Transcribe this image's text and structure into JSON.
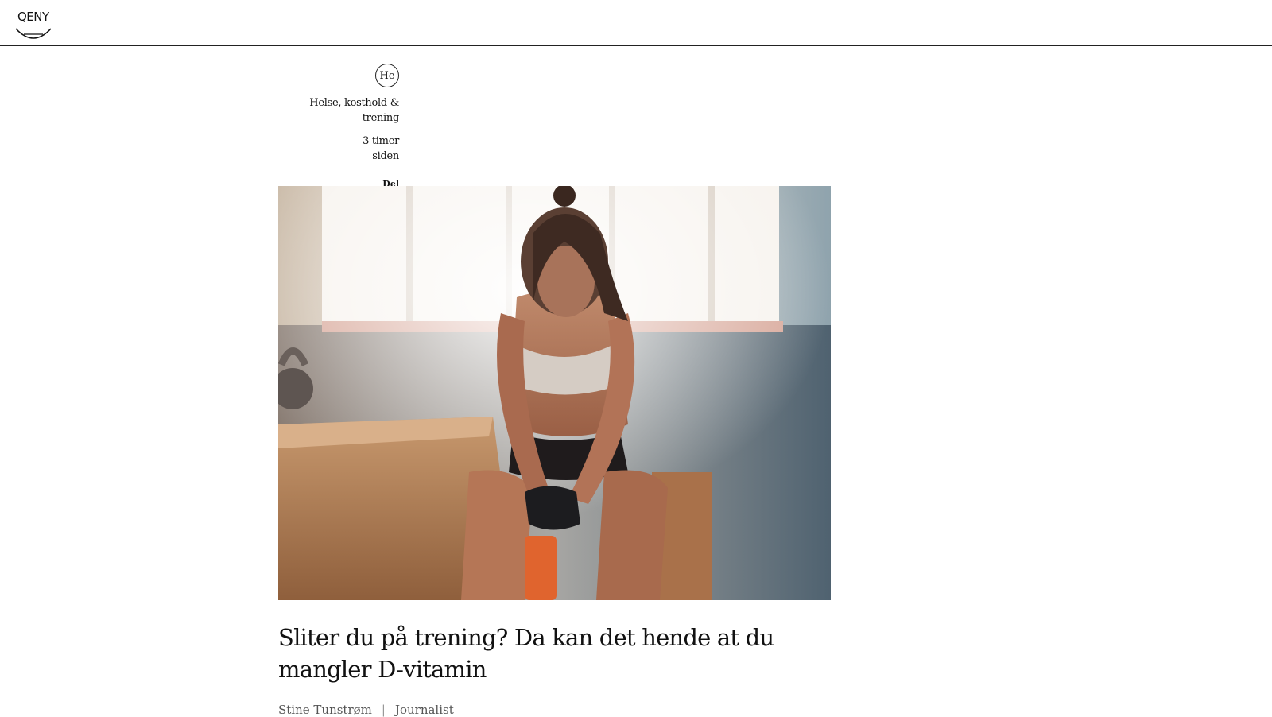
{
  "header": {
    "logo_text": "QENY"
  },
  "article": {
    "category_badge": "He",
    "category": "Helse, kosthold & trening",
    "timestamp": "3 timer siden",
    "share_label": "Del",
    "title": "Sliter du på trening? Da kan det hende at du mangler D-vitamin",
    "author": "Stine Tunstrøm",
    "author_role": "Journalist"
  }
}
